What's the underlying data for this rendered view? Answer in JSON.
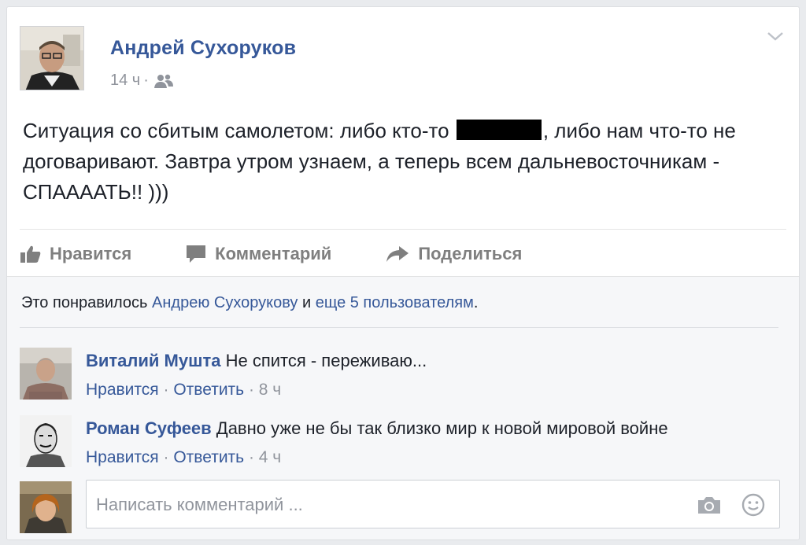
{
  "post": {
    "author": "Андрей Сухоруков",
    "time": "14 ч",
    "time_sep": "·",
    "text_part1": "Ситуация со сбитым самолетом: либо кто-то ",
    "text_part2": ", либо нам что-то не договаривают. Завтра утром узнаем, а теперь всем дальневосточникам - СПААААТЬ!! )))",
    "audience_icon": "friends-icon",
    "menu_icon": "chevron-down-icon"
  },
  "actions": {
    "like": "Нравится",
    "comment": "Комментарий",
    "share": "Поделиться"
  },
  "likes": {
    "prefix": "Это понравилось ",
    "user": "Андрею Сухорукову",
    "and": " и ",
    "others": "еще 5 пользователям",
    "suffix": "."
  },
  "comments": [
    {
      "author": "Виталий Мушта",
      "text": " Не спится - переживаю...",
      "like": "Нравится",
      "sep": " · ",
      "reply": "Ответить",
      "time": "8 ч"
    },
    {
      "author": "Роман Суфеев",
      "text": " Давно уже не бы так близко мир к новой мировой войне",
      "like": "Нравится",
      "sep": " · ",
      "reply": "Ответить",
      "time": "4 ч"
    }
  ],
  "composer": {
    "placeholder": "Написать комментарий ...",
    "camera_icon": "camera-icon",
    "emoji_icon": "smile-icon"
  },
  "colors": {
    "link": "#365899",
    "muted": "#90949c",
    "action": "#7f7f7f",
    "background": "#e9ebee"
  }
}
